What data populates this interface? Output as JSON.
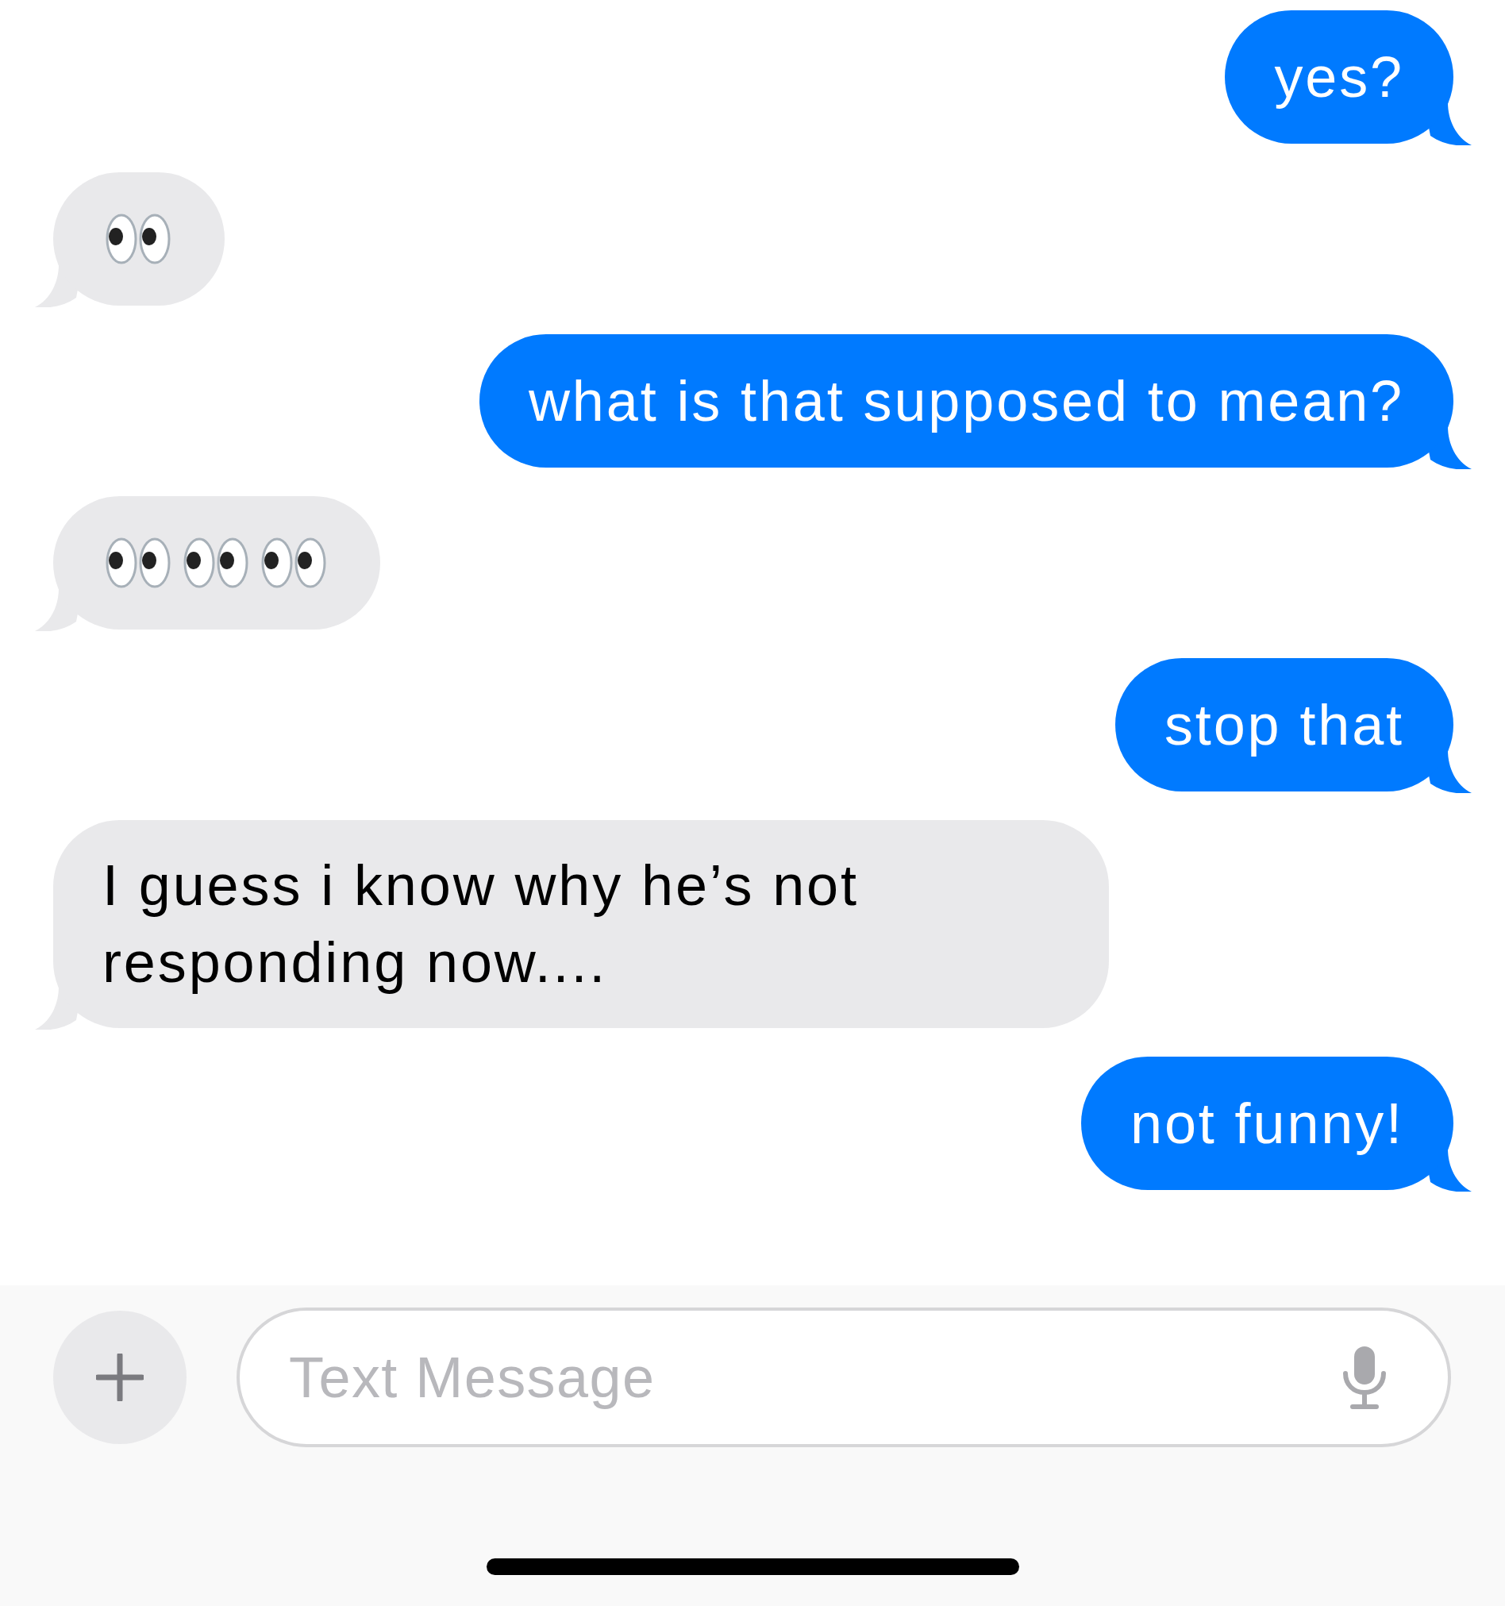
{
  "messages": [
    {
      "sent": true,
      "kind": "text",
      "text": "yes?"
    },
    {
      "sent": false,
      "kind": "emoji",
      "emoji": [
        {
          "kind": "eyes"
        }
      ]
    },
    {
      "sent": true,
      "kind": "text",
      "text": "what is that supposed to mean?"
    },
    {
      "sent": false,
      "kind": "emoji",
      "emoji": [
        {
          "kind": "eyes"
        },
        {
          "kind": "eyes"
        },
        {
          "kind": "eyes"
        }
      ]
    },
    {
      "sent": true,
      "kind": "text",
      "text": "stop that"
    },
    {
      "sent": false,
      "kind": "text",
      "text": "I guess i know why he’s not responding now...."
    },
    {
      "sent": true,
      "kind": "text",
      "text": "not funny!"
    }
  ],
  "composer": {
    "placeholder": "Text Message"
  }
}
